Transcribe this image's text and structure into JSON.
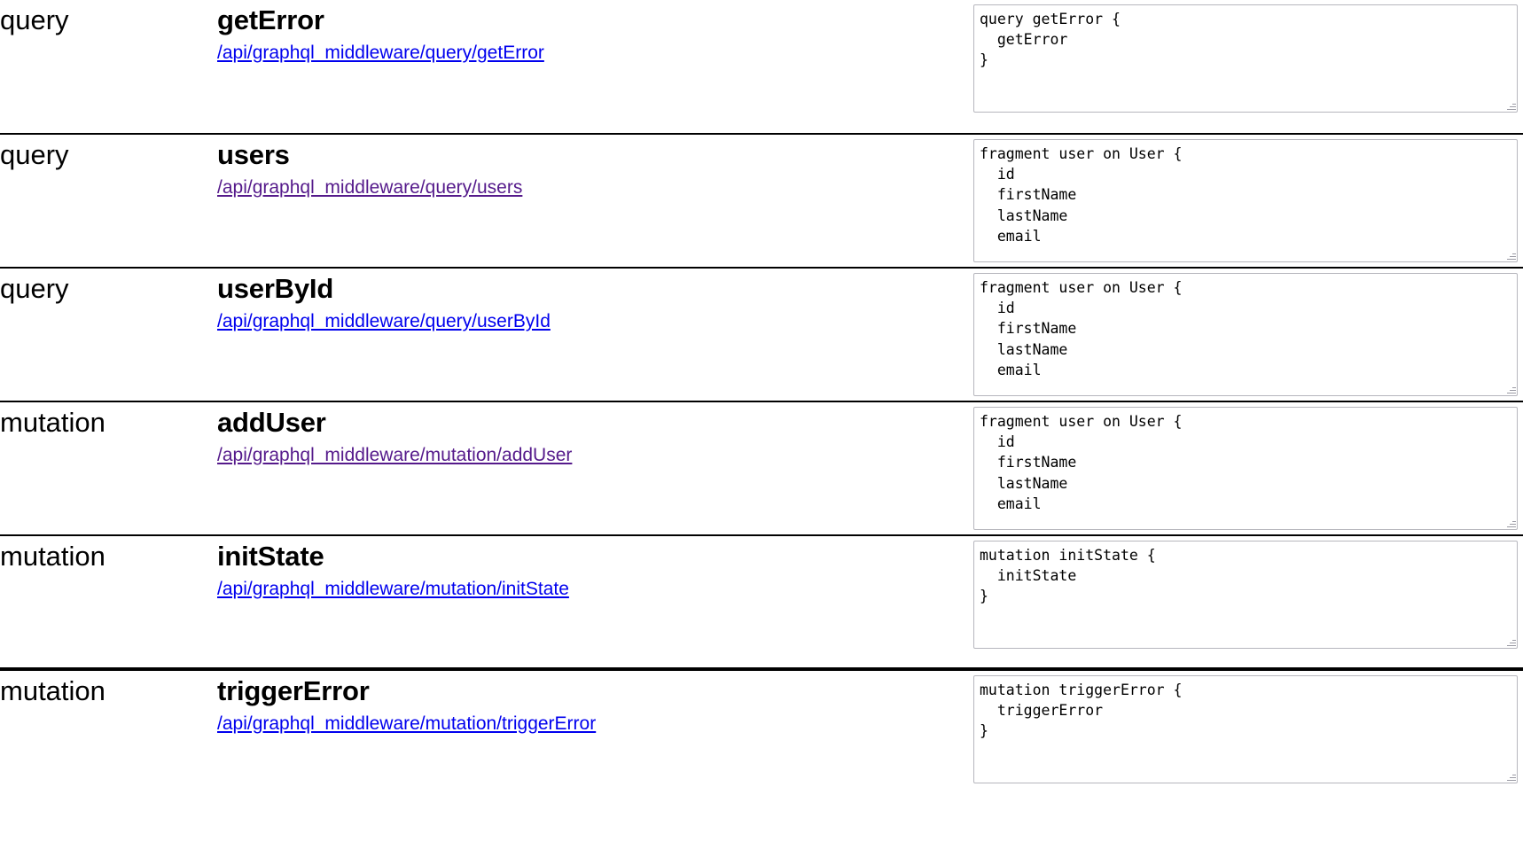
{
  "colors": {
    "link_unvisited": "#0000ee",
    "link_visited": "#551a8b",
    "separator": "#000000",
    "textarea_border": "#b6b6bd",
    "text": "#000000",
    "background": "#ffffff"
  },
  "operations": [
    {
      "type": "query",
      "name": "getError",
      "url": "/api/graphql_middleware/query/getError",
      "link_state": "unvisited",
      "code": "query getError {\n  getError\n}"
    },
    {
      "type": "query",
      "name": "users",
      "url": "/api/graphql_middleware/query/users",
      "link_state": "visited",
      "code": "fragment user on User {\n  id\n  firstName\n  lastName\n  email"
    },
    {
      "type": "query",
      "name": "userById",
      "url": "/api/graphql_middleware/query/userById",
      "link_state": "unvisited",
      "code": "fragment user on User {\n  id\n  firstName\n  lastName\n  email"
    },
    {
      "type": "mutation",
      "name": "addUser",
      "url": "/api/graphql_middleware/mutation/addUser",
      "link_state": "visited",
      "code": "fragment user on User {\n  id\n  firstName\n  lastName\n  email"
    },
    {
      "type": "mutation",
      "name": "initState",
      "url": "/api/graphql_middleware/mutation/initState",
      "link_state": "unvisited",
      "code": "mutation initState {\n  initState\n}"
    },
    {
      "type": "mutation",
      "name": "triggerError",
      "url": "/api/graphql_middleware/mutation/triggerError",
      "link_state": "unvisited",
      "code": "mutation triggerError {\n  triggerError\n}"
    }
  ]
}
